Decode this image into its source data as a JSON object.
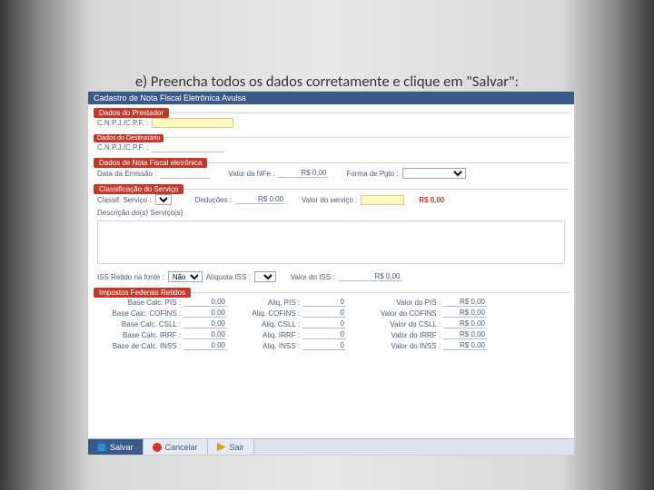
{
  "caption": "e) Preencha todos os dados corretamente e clique em \"Salvar\":",
  "titlebar": "Cadastro de Nota Fiscal Eletrônica Avulsa",
  "sections": {
    "prestador": "Dados do Prestador",
    "destinatario": "Dados do Destinatário",
    "nfe": "Dados de Nota Fiscal eletrônica",
    "classificacao": "Classificação do Serviço",
    "impostos": "Impostos Federais Retidos"
  },
  "labels": {
    "cnpj": "C.N.P.J./C.P.F. :",
    "data_emissao": "Data da Emissão :",
    "valor_nfe": "Valor da NFe :",
    "forma_pgto": "Forma de Pgto :",
    "classif_servico": "Classif. Serviço :",
    "deducoes": "Deduções :",
    "valor_servico": "Valor do serviço :",
    "descricao": "Descrição do(s) Serviço(s)",
    "iss_retido": "ISS Retido na fonte :",
    "aliquota_iss": "Alíquota ISS :",
    "valor_iss": "Valor do ISS :",
    "nao": "Não"
  },
  "values": {
    "rs000": "R$ 0,00",
    "zero": "0,00",
    "zero_int": "0"
  },
  "tax": {
    "rows": [
      {
        "base": "Base Calc. PIS :",
        "aliq": "Aliq. PIS :",
        "valor": "Valor do PIS :"
      },
      {
        "base": "Base Calc. COFINS :",
        "aliq": "Aliq. COFINS :",
        "valor": "Valor do COFINS :"
      },
      {
        "base": "Base Calc. CSLL :",
        "aliq": "Aliq. CSLL :",
        "valor": "Valor do CSLL :"
      },
      {
        "base": "Base Calc. IRRF :",
        "aliq": "Aliq. IRRF :",
        "valor": "Valor do IRRF :"
      },
      {
        "base": "Base de Calc. INSS :",
        "aliq": "Aliq. INSS :",
        "valor": "Valor do INSS :"
      }
    ]
  },
  "buttons": {
    "salvar": "Salvar",
    "cancelar": "Cancelar",
    "sair": "Sair"
  }
}
